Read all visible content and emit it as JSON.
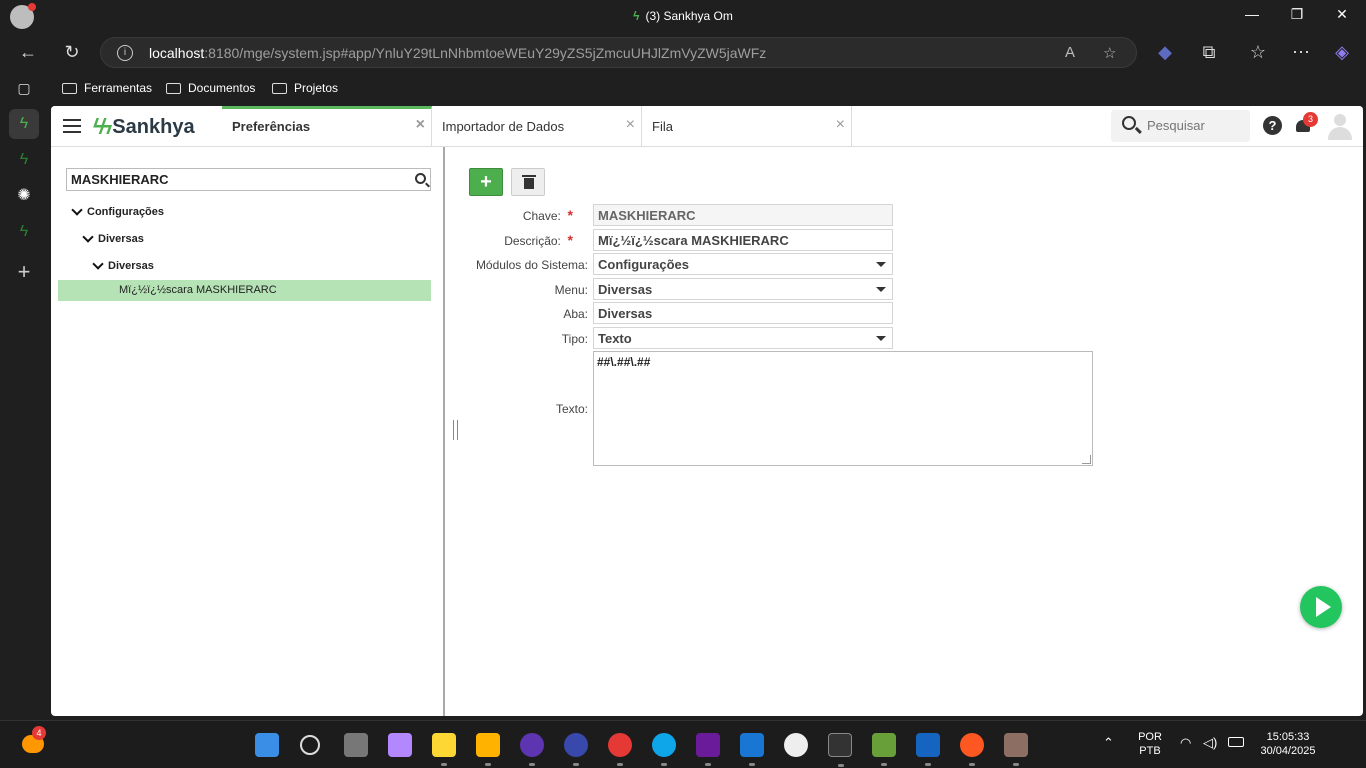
{
  "browser": {
    "window_title": "(3) Sankhya Om",
    "url_host": "localhost",
    "url_rest": ":8180/mge/system.jsp#app/YnluY29tLnNhbmtoeWEuY29yZS5jZmcuUHJlZmVyZW5jaWFz",
    "favorites": [
      {
        "label": "Ferramentas"
      },
      {
        "label": "Documentos"
      },
      {
        "label": "Projetos"
      }
    ]
  },
  "app": {
    "brand": "Sankhya",
    "tabs": [
      {
        "label": "Preferências",
        "active": true
      },
      {
        "label": "Importador de Dados",
        "active": false
      },
      {
        "label": "Fila",
        "active": false
      }
    ],
    "search_placeholder": "Pesquisar",
    "notification_count": "3",
    "help_glyph": "?"
  },
  "tree": {
    "search_value": "MASKHIERARC",
    "nodes": [
      {
        "label": "Configurações",
        "level": 0
      },
      {
        "label": "Diversas",
        "level": 1
      },
      {
        "label": "Diversas",
        "level": 2
      }
    ],
    "selected_leaf": "Mï¿½ï¿½scara MASKHIERARC"
  },
  "form": {
    "add_label": "+",
    "chave_label": "Chave:",
    "chave_value": "MASKHIERARC",
    "descricao_label": "Descrição:",
    "descricao_value": "Mï¿½ï¿½scara MASKHIERARC",
    "modulos_label": "Módulos do Sistema:",
    "modulos_value": "Configurações",
    "menu_label": "Menu:",
    "menu_value": "Diversas",
    "aba_label": "Aba:",
    "aba_value": "Diversas",
    "tipo_label": "Tipo:",
    "tipo_value": "Texto",
    "texto_label": "Texto:",
    "texto_value": "##\\.##\\.##",
    "required_mark": "*"
  },
  "taskbar": {
    "weather_badge": "4",
    "lang_line1": "POR",
    "lang_line2": "PTB",
    "time": "15:05:33",
    "date": "30/04/2025"
  },
  "colors": {
    "accent_green": "#5cb85c",
    "selected_row": "#b6e3b6",
    "play_button": "#22c55e",
    "required_red": "#d32f2f"
  }
}
